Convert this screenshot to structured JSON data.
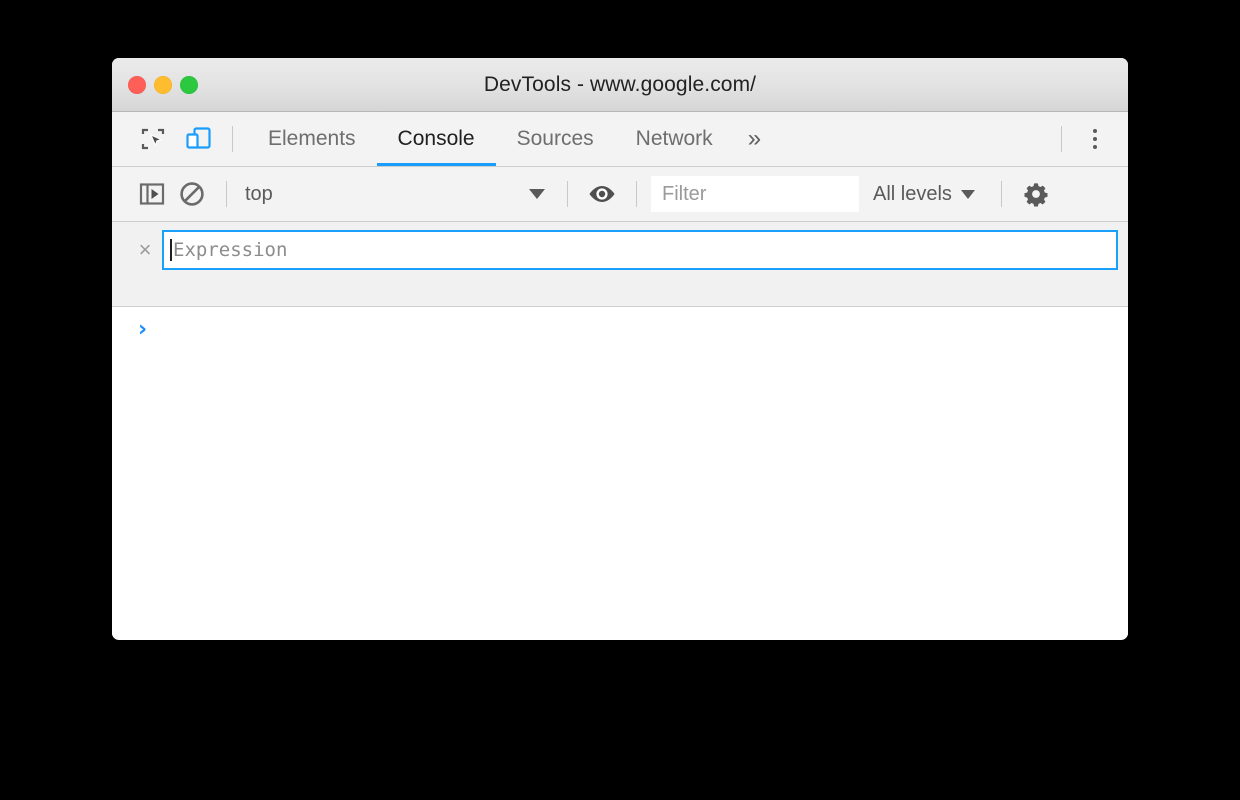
{
  "window": {
    "title": "DevTools - www.google.com/",
    "traffic_lights": [
      {
        "name": "close",
        "color": "#ff5f56"
      },
      {
        "name": "minimize",
        "color": "#febc2e"
      },
      {
        "name": "maximize",
        "color": "#2cc840"
      }
    ]
  },
  "tabbar": {
    "inspect_icon": "inspect-element-icon",
    "device_icon": "device-toolbar-icon",
    "device_icon_color": "#1a9dfc",
    "tabs": [
      {
        "label": "Elements",
        "active": false
      },
      {
        "label": "Console",
        "active": true
      },
      {
        "label": "Sources",
        "active": false
      },
      {
        "label": "Network",
        "active": false
      }
    ],
    "overflow_label": "»",
    "more_options_icon": "kebab-menu-icon",
    "active_underline_color": "#1a9dfc"
  },
  "console_toolbar": {
    "sidebar_toggle_icon": "console-sidebar-toggle-icon",
    "clear_console_icon": "clear-console-icon",
    "context": {
      "selected": "top",
      "caret": "▼"
    },
    "live_expression_icon": "eye-icon",
    "filter": {
      "value": "",
      "placeholder": "Filter"
    },
    "levels": {
      "selected": "All levels",
      "caret": "▼"
    },
    "settings_icon": "gear-icon"
  },
  "live_expression": {
    "close_label": "×",
    "value": "",
    "placeholder": "Expression",
    "border_color": "#18a0fb"
  },
  "console_output": {
    "prompt": "›",
    "prompt_color": "#1a8cff",
    "messages": []
  }
}
